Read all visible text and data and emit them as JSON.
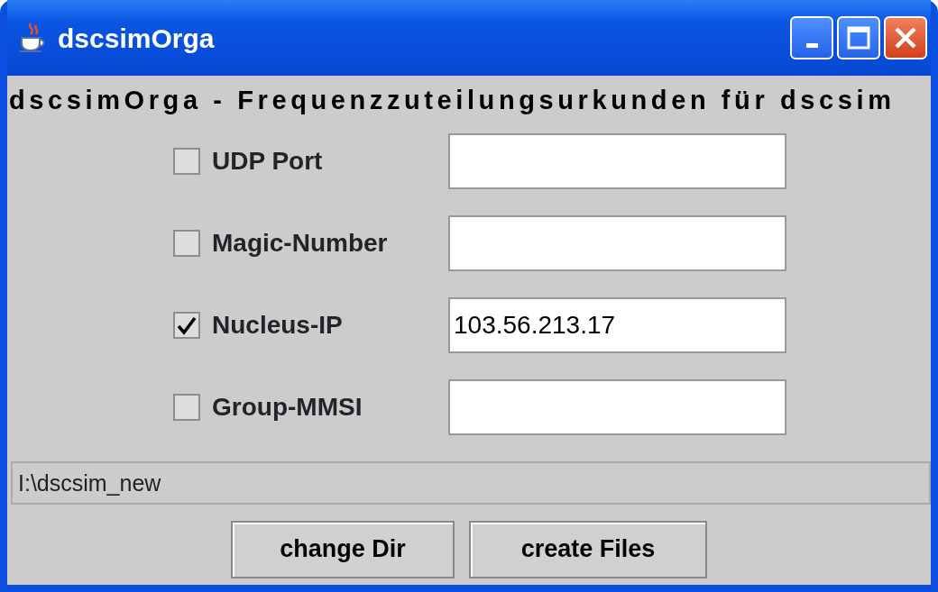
{
  "window": {
    "title": "dscsimOrga"
  },
  "heading": "dscsimOrga - Frequenzzuteilungsurkunden für dscsim",
  "options": [
    {
      "label": "UDP Port",
      "checked": false
    },
    {
      "label": "Magic-Number",
      "checked": false
    },
    {
      "label": "Nucleus-IP",
      "checked": true,
      "value": "103.56.213.17"
    },
    {
      "label": "Group-MMSI",
      "checked": false
    }
  ],
  "directory": "I:\\dscsim_new",
  "buttons": [
    "change Dir",
    "create Files"
  ]
}
